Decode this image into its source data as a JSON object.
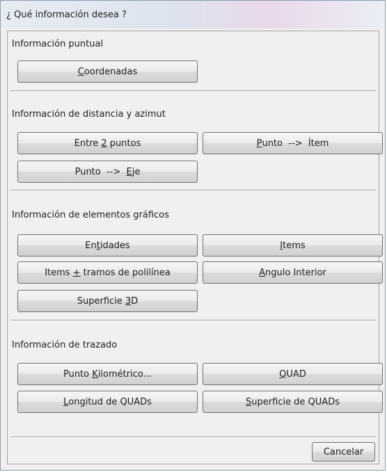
{
  "window": {
    "title": "¿ Qué información desea ?"
  },
  "sections": {
    "puntual": {
      "label": "Información puntual",
      "buttons": {
        "coordenadas": {
          "pre": "",
          "key": "C",
          "post": "oordenadas"
        }
      }
    },
    "distancia": {
      "label": "Información de distancia y azimut",
      "buttons": {
        "entre_puntos": {
          "pre": "Entre ",
          "key": "2",
          "post": " puntos"
        },
        "punto_item": {
          "pre": "",
          "key": "P",
          "post": "unto  -->  Ítem"
        },
        "punto_eje": {
          "pre": "Punto  -->  ",
          "key": "E",
          "post": "je"
        }
      }
    },
    "graficos": {
      "label": "Información de elementos gráficos",
      "buttons": {
        "entidades": {
          "pre": "En",
          "key": "t",
          "post": "idades"
        },
        "items": {
          "pre": "",
          "key": "I",
          "post": "tems"
        },
        "items_tramos": {
          "pre": "Items ",
          "key": "+",
          "post": " tramos de polilínea"
        },
        "angulo_interior": {
          "pre": "",
          "key": "A",
          "post": "ngulo Interior"
        },
        "superficie_3d": {
          "pre": "Superficie ",
          "key": "3",
          "post": "D"
        }
      }
    },
    "trazado": {
      "label": "Información de trazado",
      "buttons": {
        "punto_kilometrico": {
          "pre": "Punto ",
          "key": "K",
          "post": "ilométrico..."
        },
        "quad": {
          "pre": "",
          "key": "Q",
          "post": "UAD"
        },
        "longitud_quads": {
          "pre": "",
          "key": "L",
          "post": "ongitud de QUADs"
        },
        "superficie_quads": {
          "pre": "",
          "key": "S",
          "post": "uperficie de QUADs"
        }
      }
    }
  },
  "footer": {
    "cancel_label": "Cancelar"
  }
}
